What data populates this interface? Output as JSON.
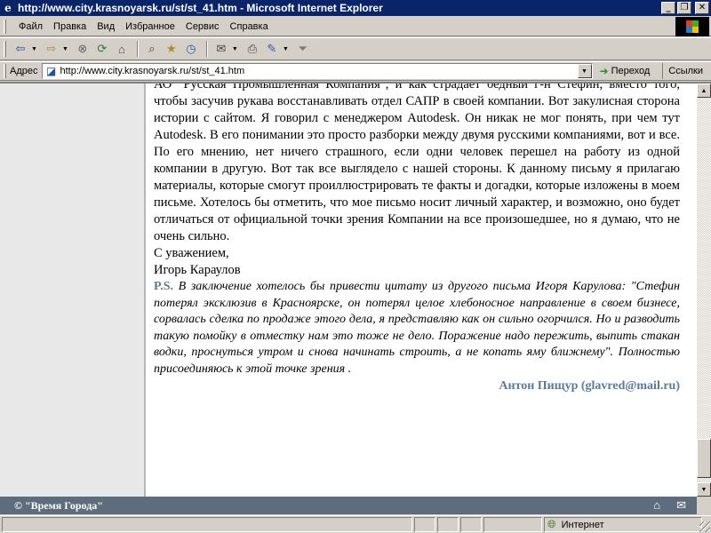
{
  "window": {
    "title": "http://www.city.krasnoyarsk.ru/st/st_41.htm - Microsoft Internet Explorer",
    "btn_minimize": "_",
    "btn_restore": "❐",
    "btn_close": "✕"
  },
  "menu": {
    "items": [
      "Файл",
      "Правка",
      "Вид",
      "Избранное",
      "Сервис",
      "Справка"
    ]
  },
  "address": {
    "label": "Адрес",
    "url": "http://www.city.krasnoyarsk.ru/st/st_41.htm",
    "go_label": "Переход",
    "links_label": "Ссылки"
  },
  "article": {
    "paragraph": "АО \"Русская Промышленная Компания\", и как страдает бедный г-н Стефин, вместо того, чтобы засучив рукава восстанавливать отдел САПР в своей компании. Вот закулисная сторона истории с сайтом. Я говорил с менеджером Autodesk. Он никак не мог понять, при чем тут Autodesk. В его понимании это просто разборки между двумя русскими компаниями, вот и все. По его мнению, нет ничего страшного, если одни человек перешел на работу из одной компании в другую. Вот так все выглядело с нашей стороны. К данному письму я прилагаю материалы, которые смогут проиллюстрировать те факты и догадки, которые изложены в моем письме. Хотелось бы отметить, что мое письмо носит личный характер, и возможно, оно будет отличаться от официальной точки зрения Компании на все произошедшее, но я думаю, что не очень сильно.",
    "regards": "С уважением,",
    "signature": "Игорь Караулов",
    "ps_label": "P.S.",
    "ps_text": " В заключение хотелось бы привести цитату из другого письма Игоря Карулова: \"Стефин потерял эксклюзив в Красноярске, он потерял целое хлебоносное направление в своем бизнесе, сорвалась сделка по продаже этого дела, я представляю как он сильно огорчился. Но и разводить такую помойку в отместку нам это тоже не дело. Поражение надо пережить, выпить стакан водки, проснуться утром и снова начинать строить, а не копать яму ближнему\". Полностью присоединяюсь к этой точке зрения .",
    "author": "Антон Пищур (glavred@mail.ru)"
  },
  "footer": {
    "copyright": "© \"Время Города\""
  },
  "status": {
    "zone": "Интернет"
  },
  "icons": [
    "ie-logo-icon",
    "back-icon",
    "forward-icon",
    "stop-icon",
    "refresh-icon",
    "home-icon",
    "search-icon",
    "favorites-icon",
    "history-icon",
    "mail-icon",
    "print-icon",
    "edit-icon",
    "messenger-icon",
    "page-icon",
    "go-arrow-icon",
    "home-footer-icon",
    "envelope-icon",
    "globe-icon"
  ],
  "colors": {
    "titlebar": "#0a246a",
    "chrome": "#d4d0c8",
    "footer_band": "#5d6d7e",
    "accent_text": "#5a7a9a"
  },
  "scroll": {
    "position_fraction": 0.92
  }
}
